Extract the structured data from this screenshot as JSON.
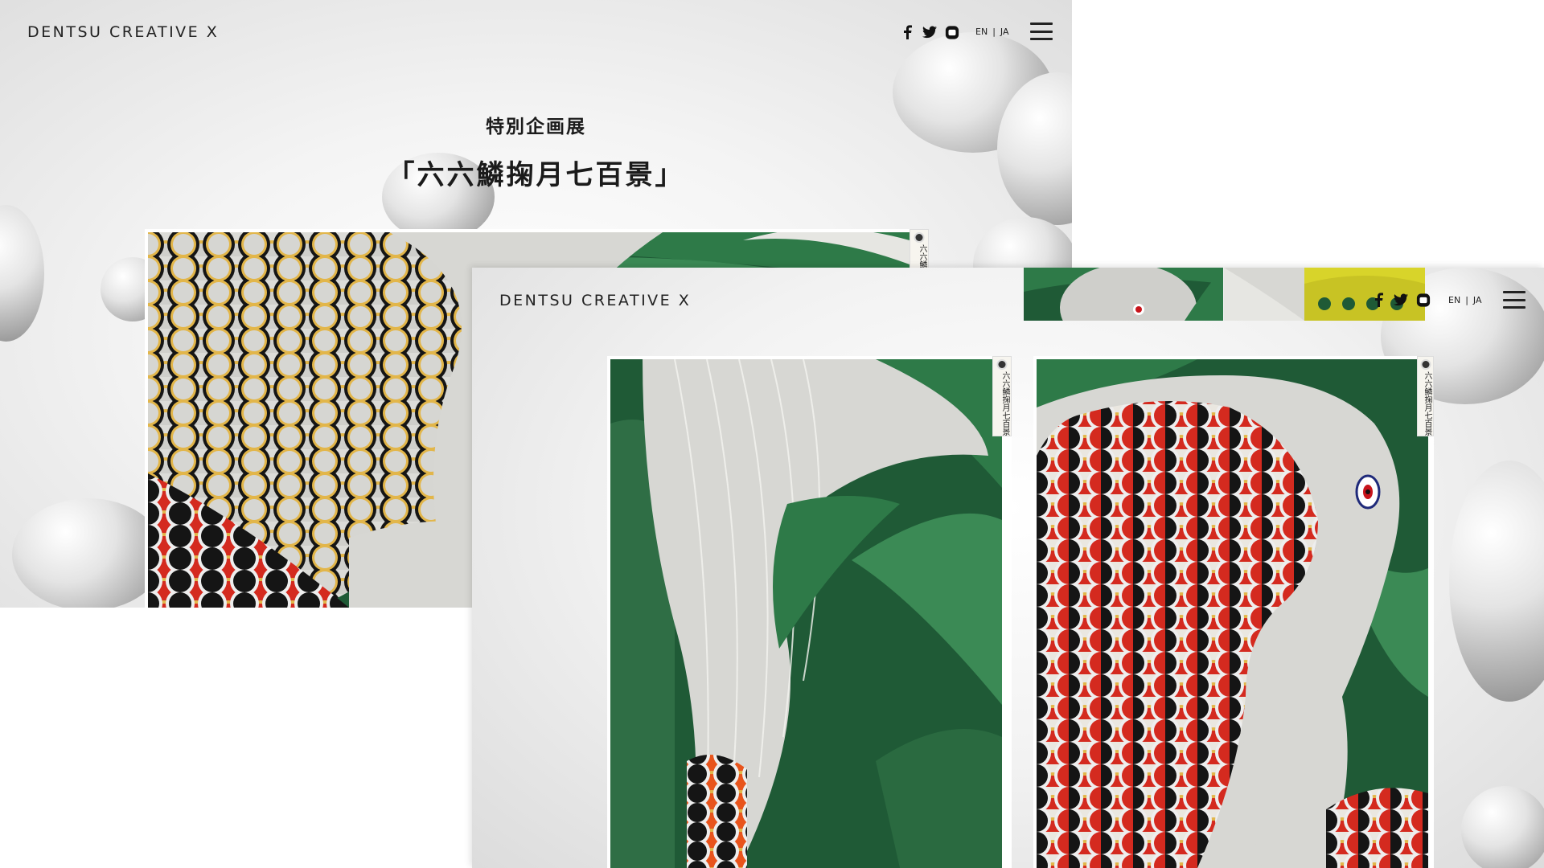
{
  "site": {
    "logo": "DENTSU CREATIVE X",
    "language": {
      "en": "EN",
      "separator": "|",
      "ja": "JA"
    },
    "social_icons": [
      "facebook-icon",
      "twitter-icon",
      "youtube-icon"
    ]
  },
  "exhibition": {
    "kicker": "特別企画展",
    "title": "「六六鱗掬月七百景」",
    "seal_text": "六六鱗掬月七百景"
  },
  "colors": {
    "koi_green": "#1f5a36",
    "koi_red": "#d42a1f",
    "koi_gold": "#e2b64a",
    "koi_black": "#151515",
    "koi_silver": "#d7d7d3",
    "koi_yellow": "#d8d42a"
  }
}
